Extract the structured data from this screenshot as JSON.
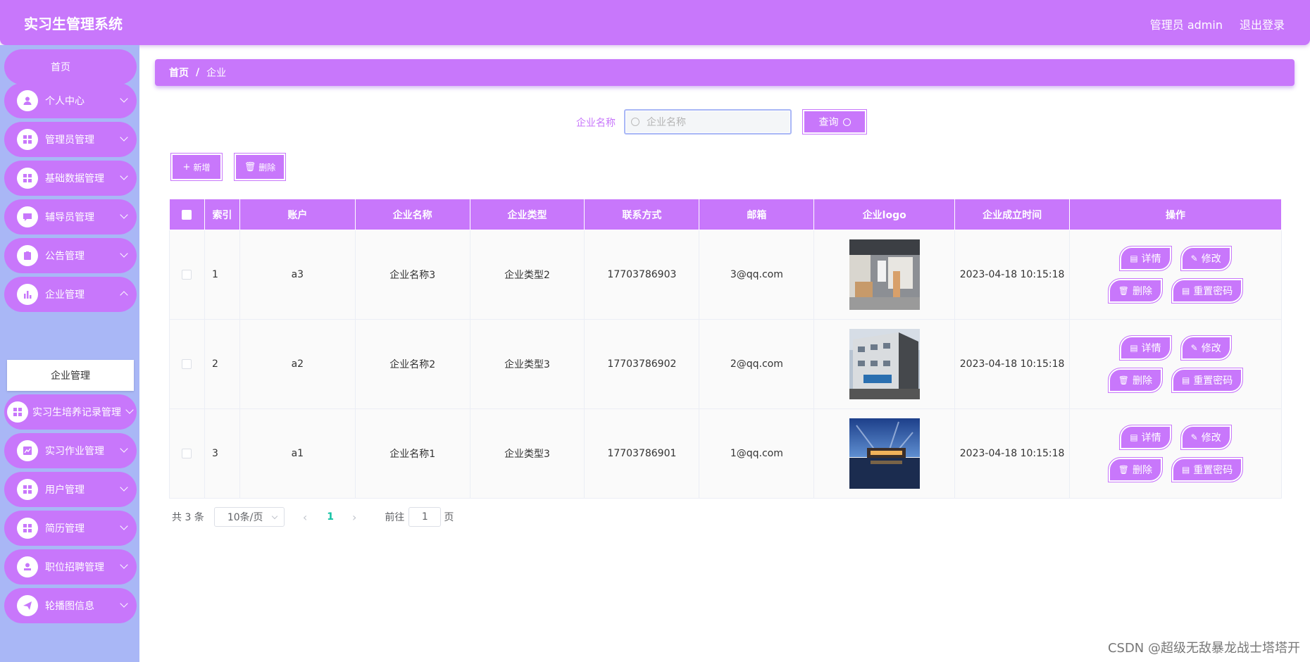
{
  "header": {
    "title": "实习生管理系统",
    "user_label": "管理员 admin",
    "logout_label": "退出登录"
  },
  "sidebar": {
    "home": "首页",
    "items": [
      {
        "label": "个人中心",
        "icon": "user-icon"
      },
      {
        "label": "管理员管理",
        "icon": "grid-icon"
      },
      {
        "label": "基础数据管理",
        "icon": "grid-icon"
      },
      {
        "label": "辅导员管理",
        "icon": "chat-icon"
      },
      {
        "label": "公告管理",
        "icon": "clipboard-icon"
      },
      {
        "label": "企业管理",
        "icon": "bar-chart-icon"
      },
      {
        "label": "实习生培养记录管理",
        "icon": "grid-icon"
      },
      {
        "label": "实习作业管理",
        "icon": "line-chart-icon"
      },
      {
        "label": "用户管理",
        "icon": "grid-icon"
      },
      {
        "label": "简历管理",
        "icon": "grid-icon"
      },
      {
        "label": "职位招聘管理",
        "icon": "stamp-icon"
      },
      {
        "label": "轮播图信息",
        "icon": "send-icon"
      }
    ],
    "active_sub": "企业管理"
  },
  "breadcrumb": {
    "home": "首页",
    "separator": "/",
    "current": "企业"
  },
  "search": {
    "label": "企业名称",
    "placeholder": "企业名称",
    "value": "",
    "button": "查询"
  },
  "actions": {
    "add": "新增",
    "delete": "删除"
  },
  "table": {
    "headers": [
      "索引",
      "账户",
      "企业名称",
      "企业类型",
      "联系方式",
      "邮箱",
      "企业logo",
      "企业成立时间",
      "操作"
    ],
    "rows": [
      {
        "index": "1",
        "account": "a3",
        "name": "企业名称3",
        "type": "企业类型2",
        "phone": "17703786903",
        "email": "3@qq.com",
        "founded": "2023-04-18 10:15:18"
      },
      {
        "index": "2",
        "account": "a2",
        "name": "企业名称2",
        "type": "企业类型3",
        "phone": "17703786902",
        "email": "2@qq.com",
        "founded": "2023-04-18 10:15:18"
      },
      {
        "index": "3",
        "account": "a1",
        "name": "企业名称1",
        "type": "企业类型3",
        "phone": "17703786901",
        "email": "1@qq.com",
        "founded": "2023-04-18 10:15:18"
      }
    ],
    "row_buttons": {
      "detail": "详情",
      "edit": "修改",
      "delete": "删除",
      "reset": "重置密码"
    }
  },
  "pagination": {
    "total": "共 3 条",
    "page_size": "10条/页",
    "current_page": "1",
    "goto_label": "前往",
    "goto_value": "1",
    "unit": "页"
  },
  "watermark": "CSDN @超级无敌暴龙战士塔塔开",
  "colors": {
    "accent": "#c877fb",
    "sidebar_bg": "#a9b7f6",
    "active_page": "#13c2a4"
  }
}
